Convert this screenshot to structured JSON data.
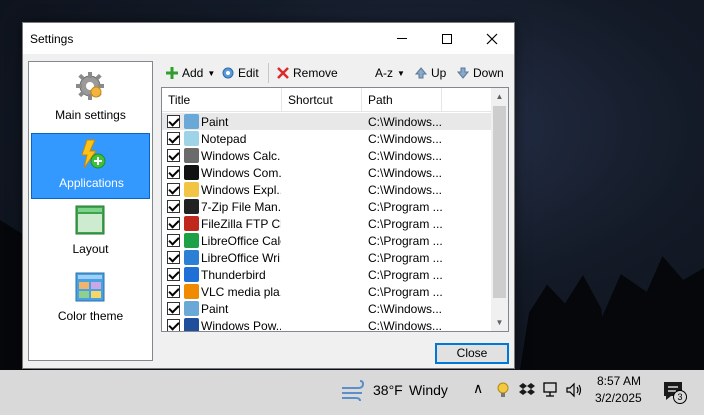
{
  "window": {
    "title": "Settings"
  },
  "nav": {
    "items": [
      {
        "label": "Main settings",
        "icon": "gear-icon",
        "active": false
      },
      {
        "label": "Applications",
        "icon": "lightning-add-icon",
        "active": true
      },
      {
        "label": "Layout",
        "icon": "layout-icon",
        "active": false
      },
      {
        "label": "Color theme",
        "icon": "palette-icon",
        "active": false
      }
    ]
  },
  "toolbar": {
    "add_label": "Add",
    "edit_label": "Edit",
    "remove_label": "Remove",
    "sort_label": "A-z",
    "up_label": "Up",
    "down_label": "Down"
  },
  "list": {
    "columns": [
      "Title",
      "Shortcut",
      "Path"
    ],
    "rows": [
      {
        "title": "Paint",
        "shortcut": "",
        "path": "C:\\Windows...",
        "icon": "paint-icon",
        "color": "#6aa8d8"
      },
      {
        "title": "Notepad",
        "shortcut": "",
        "path": "C:\\Windows...",
        "icon": "notepad-icon",
        "color": "#9fd3e8"
      },
      {
        "title": "Windows Calc...",
        "shortcut": "",
        "path": "C:\\Windows...",
        "icon": "calculator-icon",
        "color": "#6b6b6b"
      },
      {
        "title": "Windows Com...",
        "shortcut": "",
        "path": "C:\\Windows...",
        "icon": "command-prompt-icon",
        "color": "#111111"
      },
      {
        "title": "Windows Expl...",
        "shortcut": "",
        "path": "C:\\Windows...",
        "icon": "folder-icon",
        "color": "#f3c443"
      },
      {
        "title": "7-Zip File Man...",
        "shortcut": "",
        "path": "C:\\Program ...",
        "icon": "7zip-icon",
        "color": "#222222"
      },
      {
        "title": "FileZilla FTP Cl...",
        "shortcut": "",
        "path": "C:\\Program ...",
        "icon": "filezilla-icon",
        "color": "#c0281e"
      },
      {
        "title": "LibreOffice Calc",
        "shortcut": "",
        "path": "C:\\Program ...",
        "icon": "libreoffice-calc-icon",
        "color": "#1ea048"
      },
      {
        "title": "LibreOffice Wri...",
        "shortcut": "",
        "path": "C:\\Program ...",
        "icon": "libreoffice-writer-icon",
        "color": "#2b7fd4"
      },
      {
        "title": "Thunderbird",
        "shortcut": "",
        "path": "C:\\Program ...",
        "icon": "thunderbird-icon",
        "color": "#1f6fd6"
      },
      {
        "title": "VLC media pla...",
        "shortcut": "",
        "path": "C:\\Program ...",
        "icon": "vlc-icon",
        "color": "#f08a00"
      },
      {
        "title": "Paint",
        "shortcut": "",
        "path": "C:\\Windows...",
        "icon": "paint-icon",
        "color": "#6aa8d8"
      },
      {
        "title": "Windows Pow...",
        "shortcut": "",
        "path": "C:\\Windows...",
        "icon": "powershell-icon",
        "color": "#1f4f9a"
      }
    ]
  },
  "close_label": "Close",
  "taskbar": {
    "weather_temp": "38°F",
    "weather_desc": "Windy",
    "time": "8:57 AM",
    "date": "3/2/2025",
    "notification_count": "3"
  },
  "colors": {
    "accent": "#0078d7",
    "nav_active": "#3399ff"
  }
}
